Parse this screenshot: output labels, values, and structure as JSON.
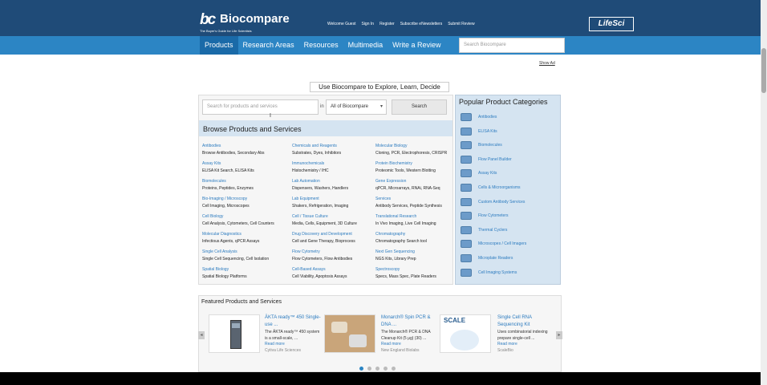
{
  "header": {
    "logo_mark": "bc",
    "logo_text": "Biocompare",
    "tagline": "The Buyer's Guide for Life Scientists",
    "utility_links": [
      "Welcome Guest",
      "Sign In",
      "Register",
      "Subscribe eNewsletters",
      "Submit Review"
    ],
    "partner_logo": "LifeSci"
  },
  "nav": {
    "items": [
      "Products",
      "Research Areas",
      "Resources",
      "Multimedia",
      "Write a Review"
    ],
    "search_placeholder": "Search Biocompare"
  },
  "show_ad": "Show Ad",
  "hero_tagline": "Use Biocompare to Explore, Learn, Decide",
  "search": {
    "placeholder": "Search for products and services",
    "in_label": "in",
    "scope": "All of Biocompare",
    "button": "Search"
  },
  "browse": {
    "title": "Browse Products and Services",
    "columns": [
      [
        {
          "title": "Antibodies",
          "sub": "Browse Antibodies, Secondary Abs"
        },
        {
          "title": "Assay Kits",
          "sub": "ELISA Kit Search, ELISA Kits"
        },
        {
          "title": "Biomolecules",
          "sub": "Proteins, Peptides, Enzymes"
        },
        {
          "title": "Bio-Imaging / Microscopy",
          "sub": "Cell Imaging, Microscopes"
        },
        {
          "title": "Cell Biology",
          "sub": "Cell Analysis, Cytometers, Cell Counters"
        },
        {
          "title": "Molecular Diagnostics",
          "sub": "Infectious Agents, qPCR Assays"
        },
        {
          "title": "Single Cell Analysis",
          "sub": "Single Cell Sequencing, Cell Isolation"
        },
        {
          "title": "Spatial Biology",
          "sub": "Spatial Biology Platforms"
        }
      ],
      [
        {
          "title": "Chemicals and Reagents",
          "sub": "Substrates, Dyes, Inhibitors"
        },
        {
          "title": "Immunochemicals",
          "sub": "Histochemistry / IHC"
        },
        {
          "title": "Lab Automation",
          "sub": "Dispensers, Washers, Handlers"
        },
        {
          "title": "Lab Equipment",
          "sub": "Shakers, Refrigeration, Imaging"
        },
        {
          "title": "Cell / Tissue Culture",
          "sub": "Media, Cells, Equipment, 3D Culture"
        },
        {
          "title": "Drug Discovery and Development",
          "sub": "Cell and Gene Therapy, Bioprocess"
        },
        {
          "title": "Flow Cytometry",
          "sub": "Flow Cytometers, Flow Antibodies"
        },
        {
          "title": "Cell-Based Assays",
          "sub": "Cell Viability, Apoptosis Assays"
        }
      ],
      [
        {
          "title": "Molecular Biology",
          "sub": "Cloning, PCR, Electrophoresis, CRISPR"
        },
        {
          "title": "Protein Biochemistry",
          "sub": "Proteomic Tools, Western Blotting"
        },
        {
          "title": "Gene Expression",
          "sub": "qPCR, Microarrays, RNAi, RNA-Seq"
        },
        {
          "title": "Services",
          "sub": "Antibody Services, Peptide Synthesis"
        },
        {
          "title": "Translational Research",
          "sub": "In Vivo Imaging, Live Cell Imaging"
        },
        {
          "title": "Chromatography",
          "sub": "Chromatography Search tool"
        },
        {
          "title": "Next Gen Sequencing",
          "sub": "NGS Kits, Library Prep"
        },
        {
          "title": "Spectroscopy",
          "sub": "Specs, Mass Spec, Plate Readers"
        }
      ]
    ]
  },
  "popular": {
    "title": "Popular Product Categories",
    "items": [
      {
        "label": "Antibodies",
        "icon": "antibody-icon"
      },
      {
        "label": "ELISA Kits",
        "icon": "elisa-kit-icon"
      },
      {
        "label": "Biomolecules",
        "icon": "biomolecule-icon"
      },
      {
        "label": "Flow Panel Builder",
        "icon": "flow-panel-icon"
      },
      {
        "label": "Assay Kits",
        "icon": "assay-kit-icon"
      },
      {
        "label": "Cells & Microorganisms",
        "icon": "petri-dish-icon"
      },
      {
        "label": "Custom Antibody Services",
        "icon": "custom-antibody-icon"
      },
      {
        "label": "Flow Cytometers",
        "icon": "flow-cytometer-icon"
      },
      {
        "label": "Thermal Cyclers",
        "icon": "thermal-cycler-icon"
      },
      {
        "label": "Microscopes / Cell Imagers",
        "icon": "microscope-icon"
      },
      {
        "label": "Microplate Readers",
        "icon": "microplate-icon"
      },
      {
        "label": "Cell Imaging Systems",
        "icon": "cell-imaging-icon"
      }
    ]
  },
  "featured": {
    "title": "Featured Products and Services",
    "items": [
      {
        "name": "ÄKTA ready™ 450 Single-use ...",
        "desc": "The ÄKTA ready™ 450 system is a small-scale, ...",
        "more": "Read more",
        "company": "Cytiva Life Sciences"
      },
      {
        "name": "Monarch® Spin PCR & DNA ...",
        "desc": "The Monarch® PCR & DNA Cleanup Kit (5 μg) (30) ...",
        "more": "Read more",
        "company": "New England Biolabs"
      },
      {
        "name": "Single Cell RNA Sequencing Kit",
        "desc": "Uses combinatorial indexing prepare single-cell ...",
        "more": "Read more",
        "company": "ScaleBio"
      }
    ],
    "scale_logo": "SCALE"
  }
}
